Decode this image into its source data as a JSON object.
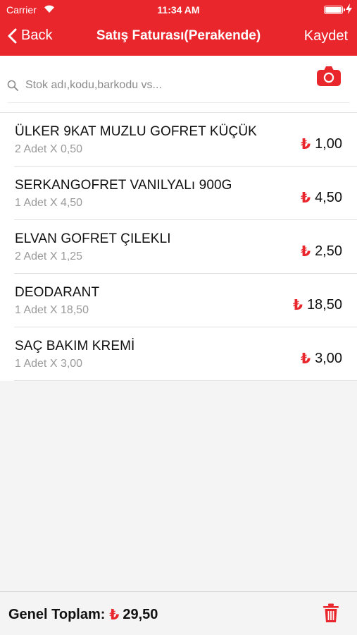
{
  "status_bar": {
    "carrier": "Carrier",
    "time": "11:34 AM"
  },
  "nav": {
    "back_label": "Back",
    "title": "Satış Faturası(Perakende)",
    "save_label": "Kaydet"
  },
  "search": {
    "placeholder": "Stok adı,kodu,barkodu vs..."
  },
  "currency_symbol": "₺",
  "items": [
    {
      "name": "ÜLKER 9KAT MUZLU GOFRET KÜÇÜK",
      "qty": "2 Adet X 0,50",
      "price": "1,00"
    },
    {
      "name": "SERKANGOFRET VANILYALı 900G",
      "qty": "1 Adet X 4,50",
      "price": "4,50"
    },
    {
      "name": "ELVAN GOFRET ÇILEKLI",
      "qty": "2 Adet X 1,25",
      "price": "2,50"
    },
    {
      "name": "DEODARANT",
      "qty": "1 Adet X 18,50",
      "price": "18,50"
    },
    {
      "name": "SAÇ BAKIM KREMİ",
      "qty": "1 Adet X 3,00",
      "price": "3,00"
    }
  ],
  "footer": {
    "total_label": "Genel Toplam:",
    "total_value": "29,50"
  },
  "colors": {
    "accent": "#e8262b",
    "background": "#f4f4f4"
  }
}
